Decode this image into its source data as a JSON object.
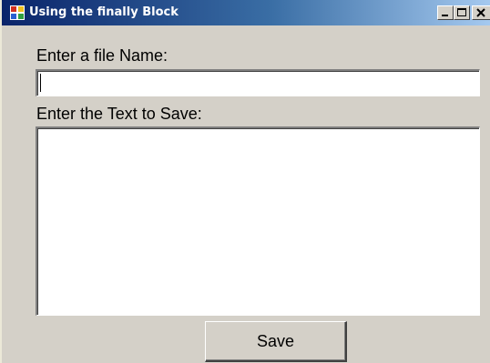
{
  "window": {
    "title": "Using the finally Block",
    "icon": "application-icon",
    "controls": [
      "minimize-icon",
      "maximize-icon",
      "close-icon"
    ]
  },
  "form": {
    "file_name_label": "Enter a file Name:",
    "file_name_value": "",
    "text_label": "Enter the Text to Save:",
    "text_value": "",
    "save_label": "Save"
  },
  "colors": {
    "title_bar_start": "#0a246a",
    "title_bar_end": "#a6caf0",
    "face": "#d4d0c8"
  }
}
